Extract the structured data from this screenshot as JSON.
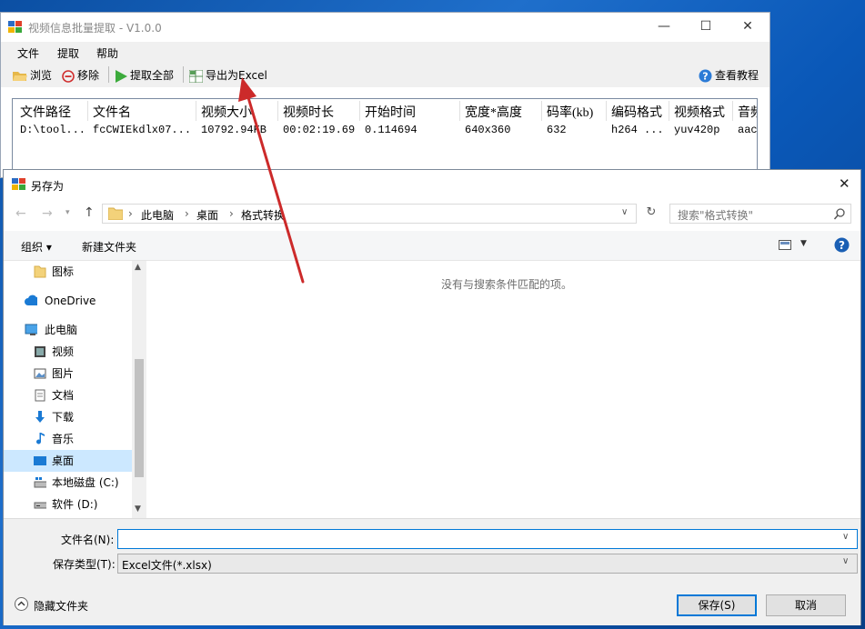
{
  "app": {
    "title": "视频信息批量提取 - V1.0.0",
    "menu": [
      "文件",
      "提取",
      "帮助"
    ],
    "toolbar": {
      "browse": "浏览",
      "remove": "移除",
      "extract_all": "提取全部",
      "export_excel": "导出为Excel",
      "tutorial": "查看教程"
    },
    "columns": [
      "文件路径",
      "文件名",
      "视频大小",
      "视频时长",
      "开始时间",
      "宽度*高度",
      "码率(kb)",
      "编码格式",
      "视频格式",
      "音频"
    ],
    "row": [
      "D:\\tool...",
      "fcCWIEkdlx07...",
      "10792.94KB",
      "00:02:19.69",
      "0.114694",
      "640x360",
      "632",
      "h264 ...",
      "yuv420p",
      "aac"
    ]
  },
  "dialog": {
    "title": "另存为",
    "breadcrumb": [
      "此电脑",
      "桌面",
      "格式转换"
    ],
    "search_placeholder": "搜索\"格式转换\"",
    "organize": "组织 ▾",
    "new_folder": "新建文件夹",
    "empty_message": "没有与搜索条件匹配的项。",
    "nav_items": [
      {
        "label": "图标",
        "icon": "folder-icon"
      },
      {
        "label": "OneDrive",
        "icon": "cloud-icon"
      },
      {
        "label": "此电脑",
        "icon": "computer-icon"
      },
      {
        "label": "视频",
        "icon": "video-icon"
      },
      {
        "label": "图片",
        "icon": "picture-icon"
      },
      {
        "label": "文档",
        "icon": "document-icon"
      },
      {
        "label": "下载",
        "icon": "download-icon"
      },
      {
        "label": "音乐",
        "icon": "music-icon"
      },
      {
        "label": "桌面",
        "icon": "desktop-icon"
      },
      {
        "label": "本地磁盘 (C:)",
        "icon": "drive-icon"
      },
      {
        "label": "软件 (D:)",
        "icon": "drive-icon"
      }
    ],
    "filename_label": "文件名(N):",
    "filename_value": "",
    "filetype_label": "保存类型(T):",
    "filetype_value": "Excel文件(*.xlsx)",
    "hide_folders": "隐藏文件夹",
    "save": "保存(S)",
    "cancel": "取消"
  },
  "colors": {
    "accent": "#cc2a2a",
    "selected_nav": "#cce8ff",
    "desktop_bg": "#1f6fcb"
  }
}
